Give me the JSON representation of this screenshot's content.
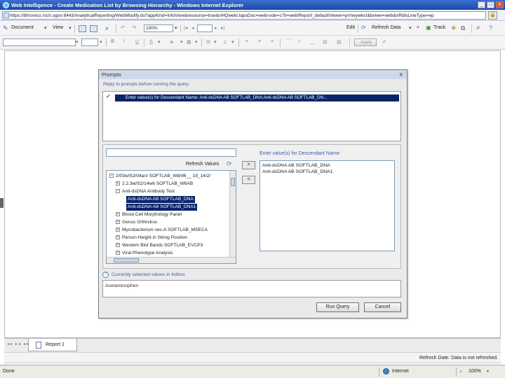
{
  "window": {
    "title": "Web Intelligence - Create Medication List by Browsing Hierarchy - Windows Internet Explorer",
    "controls": [
      "_",
      "□",
      "x"
    ]
  },
  "address": {
    "url": "https://bhrsreco.rsch.ugov:8443/AnalyticalReporting/WebiModify.do?appKind=InfoView&resource=true&nHQwebi.tapsDoc=webi-ode=c7ti=webiReport_defaultViewer=prmeyelect&bview=web&nRdlsLineType=ep"
  },
  "toolbar1": {
    "document": "Document",
    "view": "View",
    "zoom": "100%",
    "edit": "Edit",
    "refresh_data": "Refresh Data",
    "track": "Track"
  },
  "toolbar2": {
    "apply": "Apply"
  },
  "dialog": {
    "title": "Prompts",
    "close": "x",
    "instruction": "Reply to prompts before running the query.",
    "prompt_text": "Enter value(s) for Descendant Name: Anti-dsDNA AB SOFTLAB_DNA;Anti-dsDNA AB SOFTLAB_DN...",
    "refresh_values": "Refresh Values",
    "add_arrow": ">",
    "remove_arrow": "<",
    "enter_label": "Enter value(s) for Descendant Name:",
    "tree": [
      {
        "label": "2/03w/S2/04an/ SOFTLAB_W8/96__ 19_14/2/",
        "indent": 0,
        "selected": false,
        "expander": "−"
      },
      {
        "label": "2.2.3w/S2/14w6 SOFTLAB_W6AB",
        "indent": 1,
        "selected": false,
        "expander": "+"
      },
      {
        "label": "Anti-dsDNA Antibody Test",
        "indent": 1,
        "selected": false,
        "expander": "−"
      },
      {
        "label": "Anti-dsDNA AB SOFTLAB_DNA",
        "indent": 2,
        "selected": true,
        "expander": ""
      },
      {
        "label": "Anti-dsDNA AB SOFTLAB_DNA1",
        "indent": 2,
        "selected": true,
        "expander": ""
      },
      {
        "label": "Blood Cell Morphology Panel",
        "indent": 1,
        "selected": false,
        "expander": "+"
      },
      {
        "label": "Genus Orthrvirus",
        "indent": 1,
        "selected": false,
        "expander": "+"
      },
      {
        "label": "Mycobacterium sec-A SOFTLAB_MSECA",
        "indent": 1,
        "selected": false,
        "expander": "+"
      },
      {
        "label": "Person Height in String Position",
        "indent": 1,
        "selected": false,
        "expander": "+"
      },
      {
        "label": "Western Blot Bands SOFTLAB_EVCP3",
        "indent": 1,
        "selected": false,
        "expander": "+"
      },
      {
        "label": "Viral Phenotype Analysis",
        "indent": 1,
        "selected": false,
        "expander": "+"
      }
    ],
    "selected_values": [
      "Anti-dsDNA AB SOFTLAB_DNA",
      "Anti-dsDNA AB SOFTLAB_DNA1"
    ],
    "help_text": "Currently selected values in listbox",
    "info_text": "Acetaminophen",
    "run_query": "Run Query",
    "cancel": "Cancel"
  },
  "report_tab": {
    "nav": "◂◂ ◂ ▸ ▸▸",
    "label": "Report 1"
  },
  "status_strip": {
    "refresh_date": "Refresh Date: Data is not refreshed."
  },
  "ie_status": {
    "done": "Done",
    "zone": "Internet",
    "zoom": "100%"
  }
}
